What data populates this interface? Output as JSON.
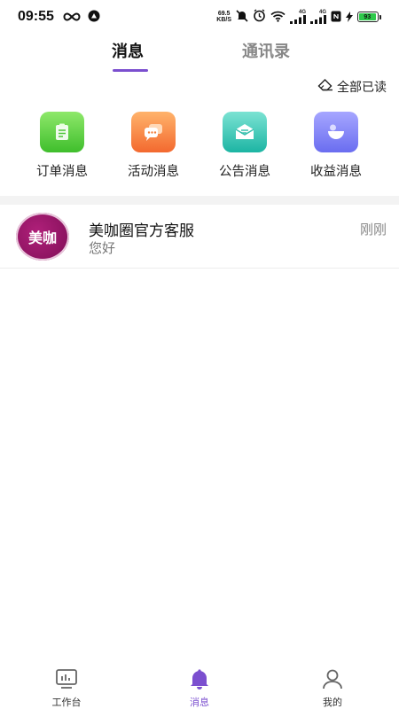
{
  "status_bar": {
    "time": "09:55",
    "net_speed_value": "69.5",
    "net_speed_unit": "KB/S",
    "signal_1_label": "4G",
    "signal_2_label": "4G",
    "battery_level": "93"
  },
  "top_tabs": [
    {
      "label": "消息",
      "active": true
    },
    {
      "label": "通讯录",
      "active": false
    }
  ],
  "mark_all_read": {
    "label": "全部已读",
    "icon": "eraser-icon"
  },
  "categories": [
    {
      "label": "订单消息",
      "icon": "clipboard-icon",
      "color_from": "#8ee86a",
      "color_to": "#3fbe2c"
    },
    {
      "label": "活动消息",
      "icon": "chat-bubbles-icon",
      "color_from": "#ffb36b",
      "color_to": "#f3692f"
    },
    {
      "label": "公告消息",
      "icon": "envelope-icon",
      "color_from": "#7be3d3",
      "color_to": "#1cb5a3"
    },
    {
      "label": "收益消息",
      "icon": "wallet-icon",
      "color_from": "#a6a6ff",
      "color_to": "#6a6df0"
    }
  ],
  "conversations": [
    {
      "name": "美咖圈官方客服",
      "message": "您好",
      "time": "刚刚",
      "avatar_text": "美咖"
    }
  ],
  "bottom_nav": [
    {
      "label": "工作台",
      "icon": "dashboard-icon",
      "active": false
    },
    {
      "label": "消息",
      "icon": "bell-icon",
      "active": true
    },
    {
      "label": "我的",
      "icon": "user-icon",
      "active": false
    }
  ],
  "colors": {
    "accent": "#7b4fcf"
  }
}
